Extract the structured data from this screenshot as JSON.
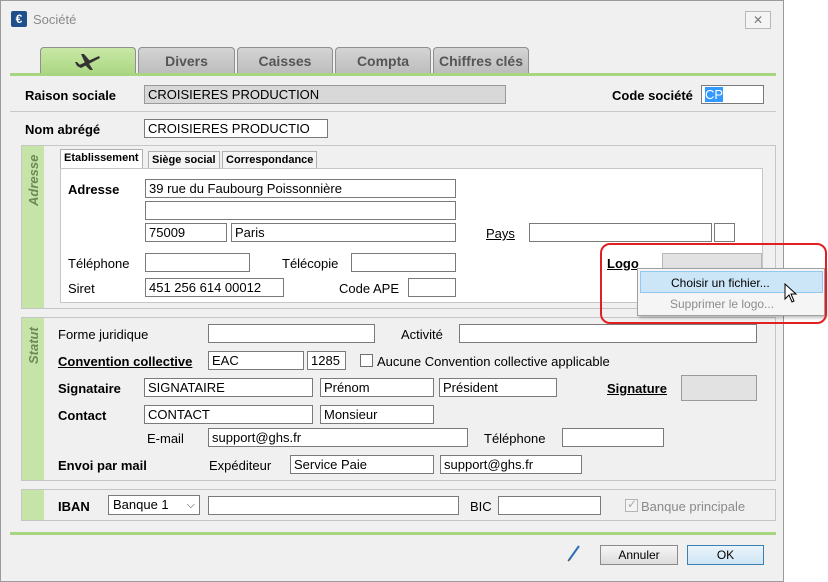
{
  "window": {
    "title": "Société",
    "close_glyph": "✕",
    "app_icon_glyph": "€"
  },
  "tabs": [
    {
      "label": "",
      "icon": "airplane-icon"
    },
    {
      "label": "Divers"
    },
    {
      "label": "Caisses"
    },
    {
      "label": "Compta"
    },
    {
      "label": "Chiffres clés"
    }
  ],
  "header": {
    "raison_sociale_label": "Raison sociale",
    "raison_sociale_value": "CROISIERES PRODUCTION",
    "code_societe_label": "Code société",
    "code_societe_value": "CP",
    "nom_abrege_label": "Nom abrégé",
    "nom_abrege_value": "CROISIERES PRODUCTIO"
  },
  "adresse": {
    "side_label": "Adresse",
    "subtabs": [
      "Etablissement",
      "Siège social",
      "Correspondance"
    ],
    "adresse_label": "Adresse",
    "line1": "39 rue du Faubourg Poissonnière",
    "line2": "",
    "code_postal": "75009",
    "ville": "Paris",
    "pays_label": "Pays",
    "pays_value": "",
    "pays_code": "",
    "telephone_label": "Téléphone",
    "telephone_value": "",
    "telecopie_label": "Télécopie",
    "telecopie_value": "",
    "logo_label": "Logo",
    "siret_label": "Siret",
    "siret_value": "451 256 614 00012",
    "code_ape_label": "Code APE",
    "code_ape_value": ""
  },
  "context_menu": {
    "items": [
      {
        "label": "Choisir un fichier...",
        "state": "hover"
      },
      {
        "label": "Supprimer le logo...",
        "state": "disabled"
      }
    ]
  },
  "statut": {
    "side_label": "Statut",
    "forme_juridique_label": "Forme juridique",
    "forme_juridique_value": "",
    "activite_label": "Activité",
    "activite_value": "",
    "convention_label": "Convention collective",
    "convention_code": "EAC",
    "convention_num": "1285",
    "aucune_convention_label": "Aucune Convention collective applicable",
    "signataire_label": "Signataire",
    "signataire_nom": "SIGNATAIRE",
    "signataire_prenom": "Prénom",
    "signataire_fonction": "Président",
    "signature_label": "Signature",
    "contact_label": "Contact",
    "contact_nom": "CONTACT",
    "contact_civilite": "Monsieur",
    "email_label": "E-mail",
    "email_value": "support@ghs.fr",
    "telephone_label": "Téléphone",
    "telephone_value": "",
    "envoi_label": "Envoi par mail",
    "expediteur_label": "Expéditeur",
    "expediteur_nom": "Service Paie",
    "expediteur_email": "support@ghs.fr"
  },
  "banque": {
    "iban_label": "IBAN",
    "banque_select": "Banque 1",
    "iban_value": "",
    "bic_label": "BIC",
    "bic_value": "",
    "principale_label": "Banque principale"
  },
  "footer": {
    "annuler_label": "Annuler",
    "ok_label": "OK"
  },
  "colors": {
    "accent_green": "#a8d580",
    "highlight_red": "#e02020",
    "selection_blue": "#3399ff"
  }
}
